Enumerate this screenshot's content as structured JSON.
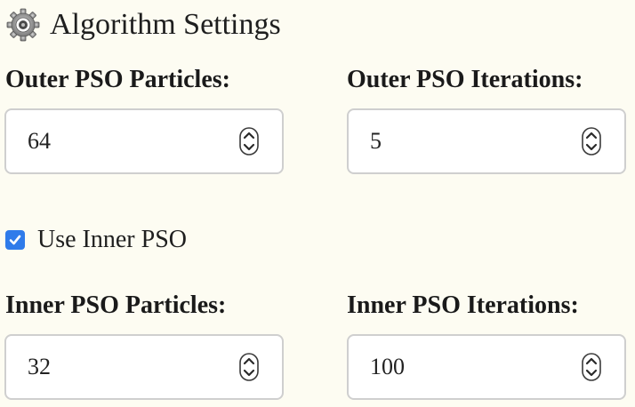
{
  "section": {
    "title": "Algorithm Settings",
    "icon": "gear-icon"
  },
  "outer": {
    "particles_label": "Outer PSO Particles:",
    "particles_value": "64",
    "iterations_label": "Outer PSO Iterations:",
    "iterations_value": "5"
  },
  "inner_toggle": {
    "label": "Use Inner PSO",
    "checked": true
  },
  "inner": {
    "particles_label": "Inner PSO Particles:",
    "particles_value": "32",
    "iterations_label": "Inner PSO Iterations:",
    "iterations_value": "100"
  },
  "colors": {
    "background": "#fdfcf2",
    "checkbox_accent": "#2f7bea",
    "input_border": "#cfcfcf"
  }
}
